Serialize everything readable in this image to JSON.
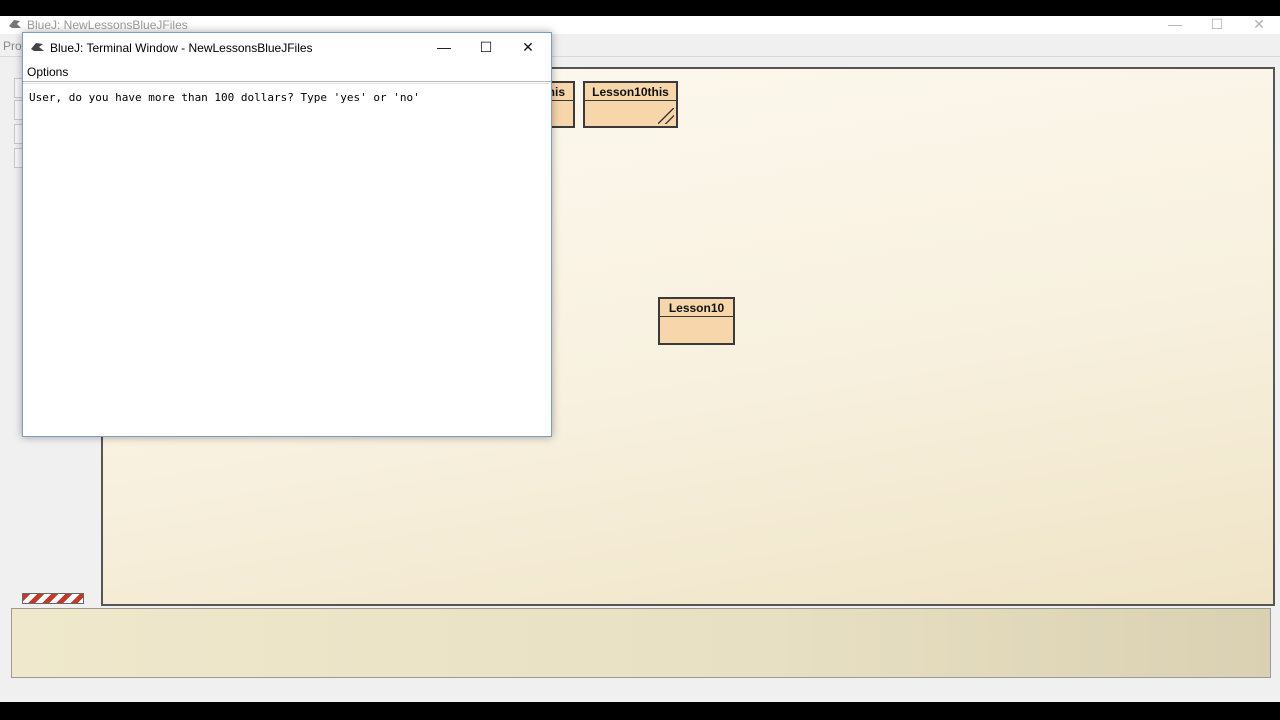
{
  "main_window": {
    "title": "BlueJ:  NewLessonsBlueJFiles",
    "menu_partial": "Pro"
  },
  "terminal": {
    "title": "BlueJ: Terminal Window - NewLessonsBlueJFiles",
    "menu": {
      "options": "Options"
    },
    "output_lines": [
      "User, do you have more than 100 dollars? Type 'yes' or 'no'"
    ]
  },
  "diagram": {
    "classes": [
      {
        "name": "his",
        "note": "partially hidden class box"
      },
      {
        "name": "Lesson10this"
      },
      {
        "name": "Lesson10"
      }
    ]
  },
  "colors": {
    "class_fill": "#f8d6ac",
    "diagram_bg": "#f8f1e0",
    "accent_border": "#7a9cc7"
  }
}
